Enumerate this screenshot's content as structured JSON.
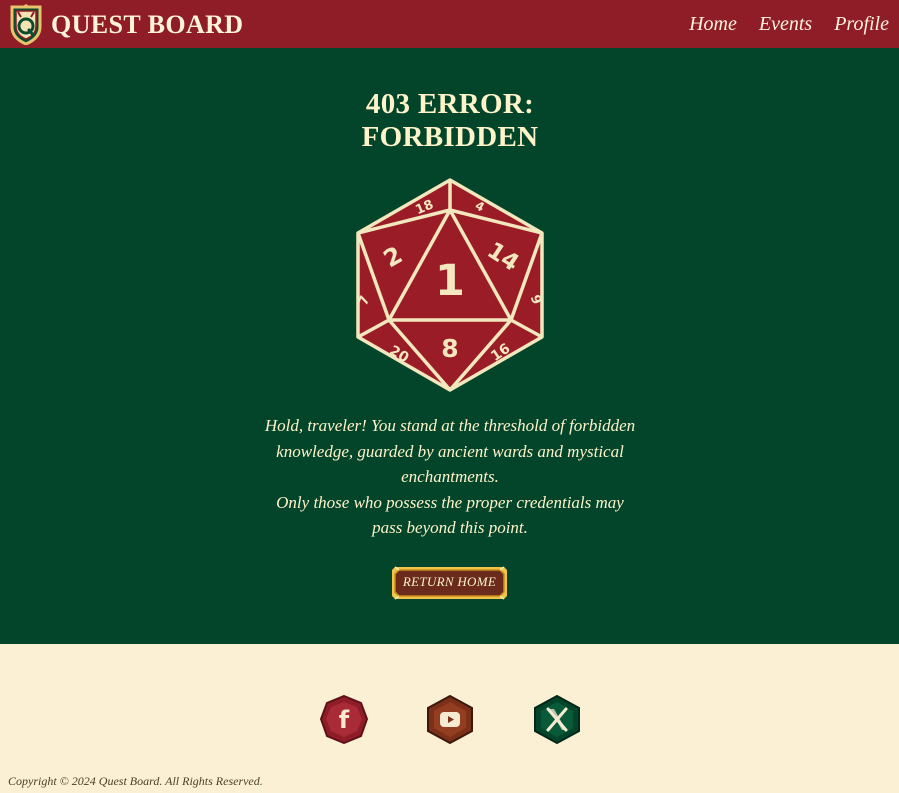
{
  "header": {
    "brand_name": "Quest Board",
    "logo_icon": "quest-board-crest-icon",
    "nav": [
      {
        "label": "Home"
      },
      {
        "label": "Events"
      },
      {
        "label": "Profile"
      }
    ]
  },
  "main": {
    "title_line1": "403 Error:",
    "title_line2": "Forbidden",
    "die": {
      "icon": "d20-die-icon",
      "faces": [
        "1",
        "2",
        "14",
        "8",
        "18",
        "4",
        "7",
        "9",
        "20",
        "16"
      ]
    },
    "message": {
      "line1": "Hold, traveler! You stand at the threshold of forbidden knowledge, guarded by ancient wards and mystical enchantments.",
      "line2": "Only those who possess the proper credentials may pass beyond this point."
    },
    "return_button": "Return Home"
  },
  "footer": {
    "social": [
      {
        "name": "facebook",
        "icon": "facebook-icon",
        "color": "#8f1d28"
      },
      {
        "name": "youtube",
        "icon": "youtube-icon",
        "color": "#5a2414"
      },
      {
        "name": "x",
        "icon": "x-icon",
        "color": "#03452a"
      }
    ],
    "copyright": "Copyright © 2024 Quest Board. All Rights Reserved."
  },
  "colors": {
    "header_bg": "#8f1d28",
    "main_bg": "#03452a",
    "footer_bg": "#fbf0d4",
    "cream_text": "#fff3c9",
    "gold": "#f2c34a"
  }
}
